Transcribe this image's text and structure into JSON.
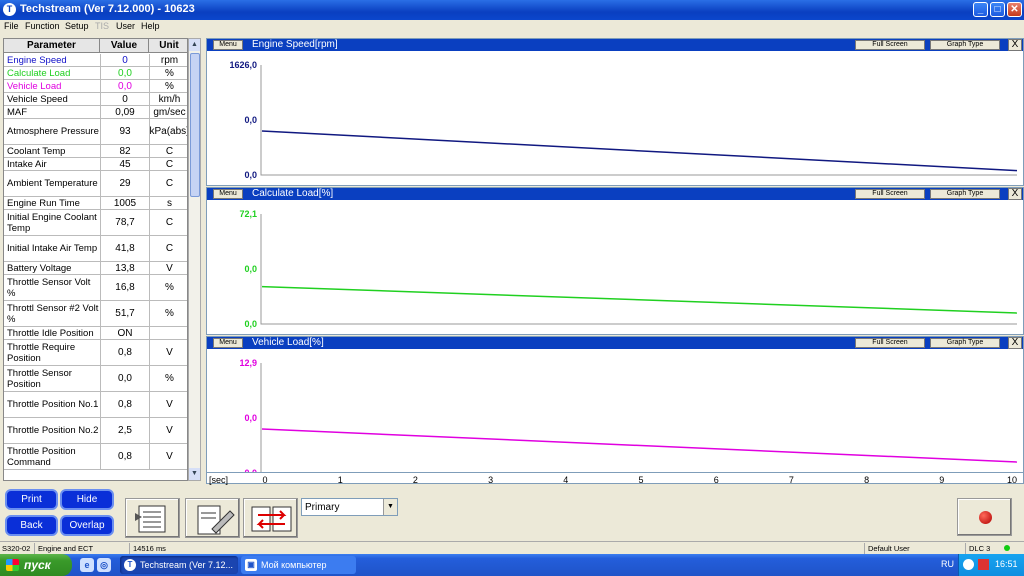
{
  "window": {
    "icon_glyph": "T",
    "title": "Techstream (Ver 7.12.000) - 10623",
    "min_glyph": "_",
    "max_glyph": "□",
    "close_glyph": "✕"
  },
  "menu": [
    "File",
    "Function",
    "Setup",
    "TIS",
    "User",
    "Help"
  ],
  "table": {
    "headers": [
      "Parameter",
      "Value",
      "Unit"
    ],
    "rows": [
      {
        "name": "Engine Speed",
        "value": "0",
        "unit": "rpm",
        "color": "#1010c8"
      },
      {
        "name": "Calculate Load",
        "value": "0,0",
        "unit": "%",
        "color": "#20d020"
      },
      {
        "name": "Vehicle Load",
        "value": "0,0",
        "unit": "%",
        "color": "#e000e0"
      },
      {
        "name": "Vehicle Speed",
        "value": "0",
        "unit": "km/h",
        "color": "#000000"
      },
      {
        "name": "MAF",
        "value": "0,09",
        "unit": "gm/sec",
        "color": "#000000"
      },
      {
        "name": "Atmosphere Pressure",
        "value": "93",
        "unit": "kPa(abs)",
        "color": "#000000"
      },
      {
        "name": "Coolant Temp",
        "value": "82",
        "unit": "C",
        "color": "#000000"
      },
      {
        "name": "Intake Air",
        "value": "45",
        "unit": "C",
        "color": "#000000"
      },
      {
        "name": "Ambient Temperature",
        "value": "29",
        "unit": "C",
        "color": "#000000"
      },
      {
        "name": "Engine Run Time",
        "value": "1005",
        "unit": "s",
        "color": "#000000"
      },
      {
        "name": "Initial Engine Coolant Temp",
        "value": "78,7",
        "unit": "C",
        "color": "#000000"
      },
      {
        "name": "Initial Intake Air Temp",
        "value": "41,8",
        "unit": "C",
        "color": "#000000"
      },
      {
        "name": "Battery Voltage",
        "value": "13,8",
        "unit": "V",
        "color": "#000000"
      },
      {
        "name": "Throttle Sensor Volt %",
        "value": "16,8",
        "unit": "%",
        "color": "#000000"
      },
      {
        "name": "Throttl Sensor #2 Volt %",
        "value": "51,7",
        "unit": "%",
        "color": "#000000"
      },
      {
        "name": "Throttle Idle Position",
        "value": "ON",
        "unit": "",
        "color": "#000000"
      },
      {
        "name": "Throttle Require Position",
        "value": "0,8",
        "unit": "V",
        "color": "#000000"
      },
      {
        "name": "Throttle Sensor Position",
        "value": "0,0",
        "unit": "%",
        "color": "#000000"
      },
      {
        "name": "Throttle Position No.1",
        "value": "0,8",
        "unit": "V",
        "color": "#000000"
      },
      {
        "name": "Throttle Position No.2",
        "value": "2,5",
        "unit": "V",
        "color": "#000000"
      },
      {
        "name": "Throttle Position Command",
        "value": "0,8",
        "unit": "V",
        "color": "#000000"
      }
    ]
  },
  "graphs": [
    {
      "menu_label": "Menu",
      "title": "Engine Speed[rpm]",
      "full_screen": "Full Screen",
      "graph_type": "Graph Type",
      "close": "X",
      "y_top": "1626,0",
      "y_mid": "0,0",
      "y_bottom": "0,0",
      "color": "#101880",
      "line_start": 0.0,
      "line_end": 0.0
    },
    {
      "menu_label": "Menu",
      "title": "Calculate Load[%]",
      "full_screen": "Full Screen",
      "graph_type": "Graph Type",
      "close": "X",
      "y_top": "72,1",
      "y_mid": "0,0",
      "y_bottom": "0,0",
      "color": "#20d020",
      "line_start": 0.0,
      "line_end": 0.0
    },
    {
      "menu_label": "Menu",
      "title": "Vehicle Load[%]",
      "full_screen": "Full Screen",
      "graph_type": "Graph Type",
      "close": "X",
      "y_top": "12,9",
      "y_mid": "0,0",
      "y_bottom": "0,0",
      "color": "#e000e0",
      "line_start": 0.0,
      "line_end": 0.0
    }
  ],
  "x_axis": {
    "unit_label": "[sec]",
    "ticks": [
      "0",
      "1",
      "2",
      "3",
      "4",
      "5",
      "6",
      "7",
      "8",
      "9",
      "10"
    ]
  },
  "buttons": {
    "print": "Print",
    "hide": "Hide",
    "back": "Back",
    "overlap": "Overlap"
  },
  "select": {
    "value": "Primary"
  },
  "status": {
    "code": "S320-02",
    "system": "Engine and ECT",
    "time": "14516 ms",
    "user": "Default User",
    "dlc": "DLC 3"
  },
  "taskbar": {
    "start": "пуск",
    "items": [
      "Techstream (Ver 7.12...",
      "Мой компьютер"
    ],
    "lang": "RU",
    "clock": "16:51"
  }
}
